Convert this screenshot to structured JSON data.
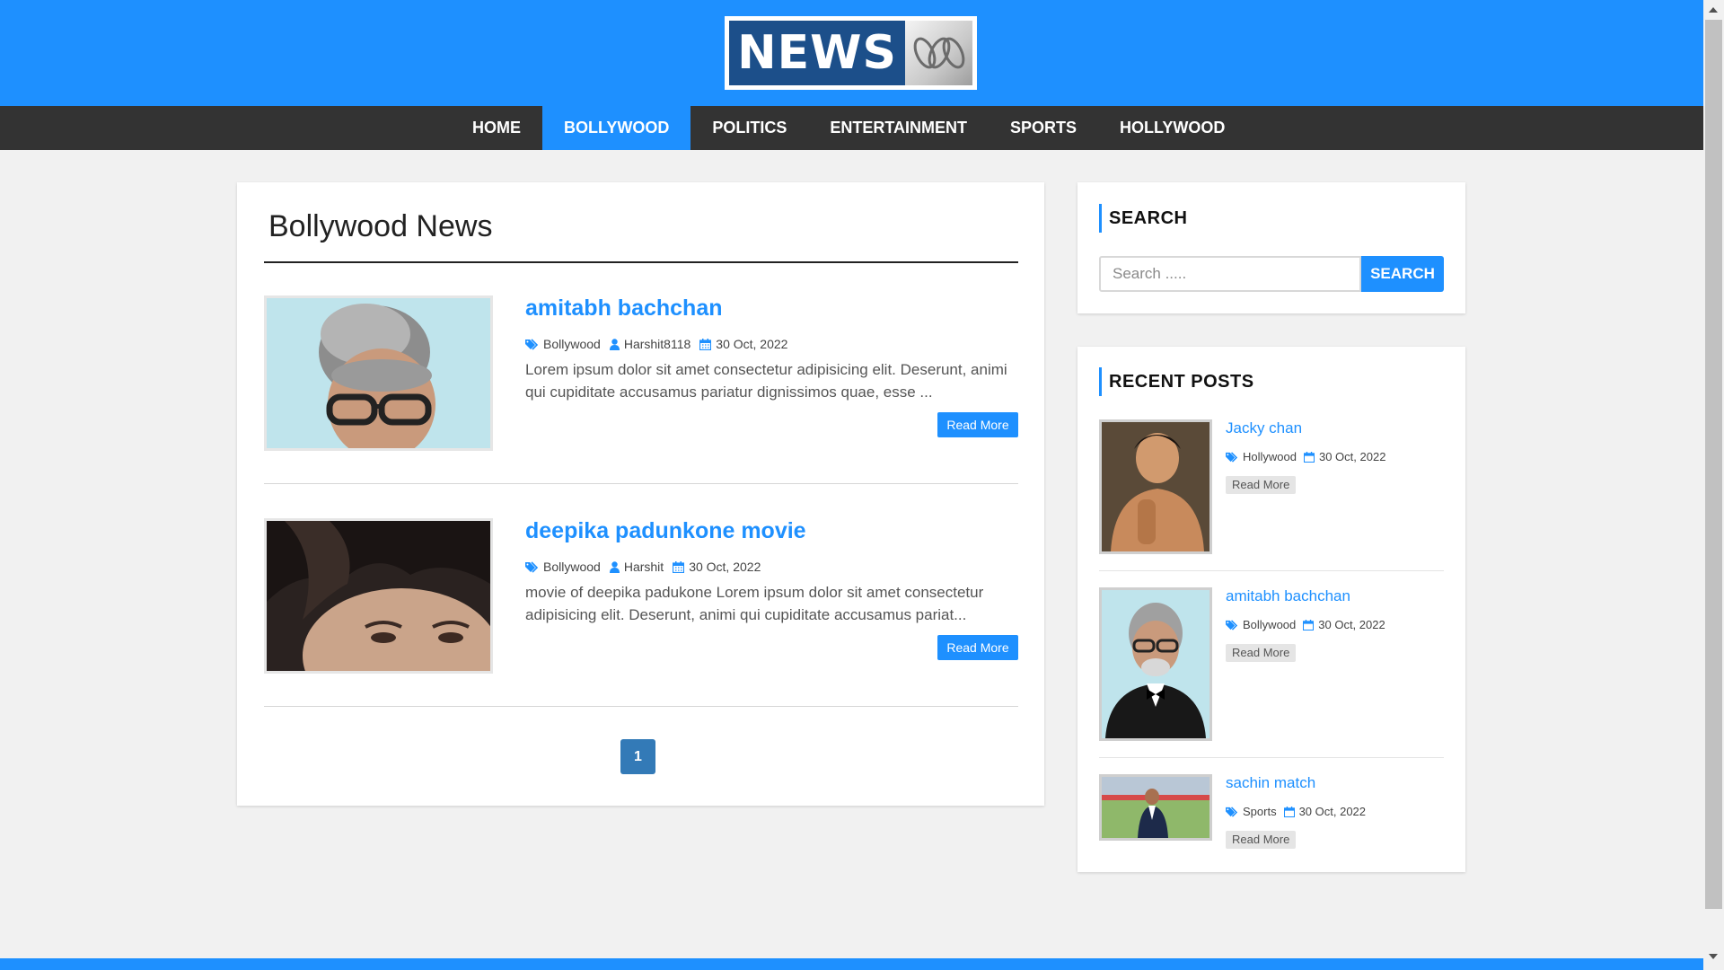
{
  "logo": {
    "text": "NEWS",
    "mark": "abc-logo-icon"
  },
  "nav": {
    "items": [
      {
        "label": "HOME"
      },
      {
        "label": "BOLLYWOOD"
      },
      {
        "label": "POLITICS"
      },
      {
        "label": "ENTERTAINMENT"
      },
      {
        "label": "SPORTS"
      },
      {
        "label": "HOLLYWOOD"
      }
    ],
    "active": "BOLLYWOOD"
  },
  "main": {
    "title": "Bollywood News",
    "posts": [
      {
        "title": "amitabh bachchan",
        "category": "Bollywood",
        "author": "Harshit8118",
        "date": "30 Oct, 2022",
        "excerpt": "Lorem ipsum dolor sit amet consectetur adipisicing elit. Deserunt, animi qui cupiditate accusamus pariatur dignissimos quae, esse ...",
        "read_more": "Read More"
      },
      {
        "title": "deepika padunkone movie",
        "category": "Bollywood",
        "author": "Harshit",
        "date": "30 Oct, 2022",
        "excerpt": "movie of deepika padukone Lorem ipsum dolor sit amet consectetur adipisicing elit. Deserunt, animi qui cupiditate accusamus pariat...",
        "read_more": "Read More"
      }
    ],
    "pagination": {
      "current": "1"
    }
  },
  "sidebar": {
    "search": {
      "title": "SEARCH",
      "placeholder": "Search .....",
      "button": "SEARCH"
    },
    "recent": {
      "title": "RECENT POSTS",
      "items": [
        {
          "title": "Jacky chan",
          "category": "Hollywood",
          "date": "30 Oct, 2022",
          "read_more": "Read More"
        },
        {
          "title": "amitabh bachchan",
          "category": "Bollywood",
          "date": "30 Oct, 2022",
          "read_more": "Read More"
        },
        {
          "title": "sachin match",
          "category": "Sports",
          "date": "30 Oct, 2022",
          "read_more": "Read More"
        }
      ]
    }
  },
  "colors": {
    "primary": "#1e90ff",
    "nav_bg": "#333333",
    "page_bg": "#f1f1f1",
    "pagination": "#337ab7"
  }
}
